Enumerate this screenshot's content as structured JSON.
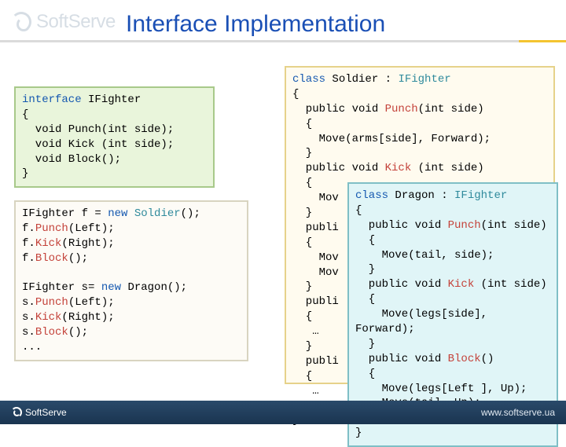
{
  "brand": {
    "name": "SoftServe",
    "url": "www.softserve.ua"
  },
  "title": "Interface Implementation",
  "code_interface": "<span class=\"kw\">interface</span> IFighter\n{\n  void Punch(int side);\n  void Kick (int side);\n  void Block();\n}",
  "code_usage": "IFighter f = <span class=\"kw\">new</span> <span class=\"typ\">Soldier</span>();\nf.<span class=\"mtd\">Punch</span>(Left);\nf.<span class=\"mtd\">Kick</span>(Right);\nf.<span class=\"mtd\">Block</span>();\n\nIFighter s= <span class=\"kw\">new</span> Dragon();\ns.<span class=\"mtd\">Punch</span>(Left);\ns.<span class=\"mtd\">Kick</span>(Right);\ns.<span class=\"mtd\">Block</span>();\n...",
  "code_soldier": "<span class=\"kw\">class</span> Soldier : <span class=\"typ\">IFighter</span>\n{\n  public void <span class=\"mtd\">Punch</span>(int side)\n  {\n    Move(arms[side], Forward);\n  }\n  public void <span class=\"mtd\">Kick</span> (int side)\n  {\n    Mov\n  }\n  publi\n  {\n    Mov\n    Mov\n  }\n  publi\n  {\n   …\n  }\n  publi\n  {\n   …\n  }\n}",
  "code_dragon": "<span class=\"kw\">class</span> Dragon : <span class=\"typ\">IFighter</span>\n{\n  public void <span class=\"mtd\">Punch</span>(int side)\n  {\n    Move(tail, side);\n  }\n  public void <span class=\"mtd\">Kick</span> (int side)\n  {\n    Move(legs[side],\nForward);\n  }\n  public void <span class=\"mtd\">Block</span>()\n  {\n    Move(legs[Left ], Up);\n    Move(tail, Up);\n  }\n}"
}
